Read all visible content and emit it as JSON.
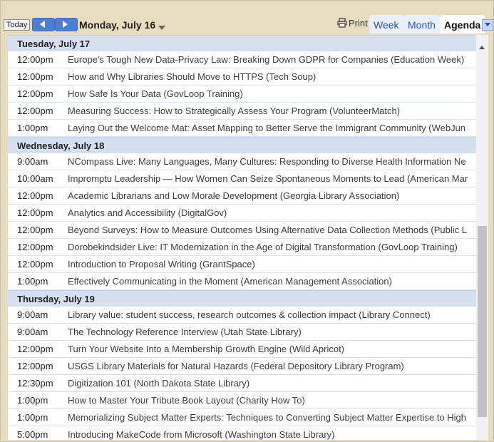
{
  "toolbar": {
    "today_label": "Today",
    "date_label": "Monday, July 16",
    "print_label": "Print",
    "tabs": [
      {
        "label": "Week"
      },
      {
        "label": "Month"
      },
      {
        "label": "Agenda"
      }
    ]
  },
  "agenda": [
    {
      "day": "Tuesday, July 17",
      "events": [
        {
          "time": "12:00pm",
          "title": "Europe's Tough New Data-Privacy Law: Breaking Down GDPR for Companies (Education Week)"
        },
        {
          "time": "12:00pm",
          "title": "How and Why Libraries Should Move to HTTPS (Tech Soup)"
        },
        {
          "time": "12:00pm",
          "title": "How Safe Is Your Data (GovLoop Training)"
        },
        {
          "time": "12:00pm",
          "title": "Measuring Success: How to Strategically Assess Your Program (VolunteerMatch)"
        },
        {
          "time": "1:00pm",
          "title": "Laying Out the Welcome Mat: Asset Mapping to Better Serve the Immigrant Community (WebJun"
        }
      ]
    },
    {
      "day": "Wednesday, July 18",
      "events": [
        {
          "time": "9:00am",
          "title": "NCompass Live: Many Languages, Many Cultures: Responding to Diverse Health Information Ne"
        },
        {
          "time": "10:00am",
          "title": "Impromptu Leadership — How Women Can Seize Spontaneous Moments to Lead (American Mar"
        },
        {
          "time": "12:00pm",
          "title": "Academic Librarians and Low Morale Development (Georgia Library Association)"
        },
        {
          "time": "12:00pm",
          "title": "Analytics and Accessibility (DigitalGov)"
        },
        {
          "time": "12:00pm",
          "title": "Beyond Surveys: How to Measure Outcomes Using Alternative Data Collection Methods (Public L"
        },
        {
          "time": "12:00pm",
          "title": "Dorobekindsider Live: IT Modernization in the Age of Digital Transformation (GovLoop Training)"
        },
        {
          "time": "12:00pm",
          "title": "Introduction to Proposal Writing (GrantSpace)"
        },
        {
          "time": "1:00pm",
          "title": "Effectively Communicating in the Moment (American Management Association)"
        }
      ]
    },
    {
      "day": "Thursday, July 19",
      "events": [
        {
          "time": "9:00am",
          "title": "Library value: student success, research outcomes & collection impact (Library Connect)"
        },
        {
          "time": "9:00am",
          "title": "The Technology Reference Interview (Utah State Library)"
        },
        {
          "time": "12:00pm",
          "title": "Turn Your Website Into a Membership Growth Engine (Wild Apricot)"
        },
        {
          "time": "12:00pm",
          "title": "USGS Library Materials for Natural Hazards (Federal Depository Library Program)"
        },
        {
          "time": "12:30pm",
          "title": "Digitization 101 (North Dakota State Library)"
        },
        {
          "time": "1:00pm",
          "title": "How to Master Your Tribute Book Layout (Charity How To)"
        },
        {
          "time": "1:00pm",
          "title": "Memorializing Subject Matter Experts: Techniques to Converting Subject Matter Expertise to High"
        },
        {
          "time": "5:00pm",
          "title": "Introducing MakeCode from Microsoft (Washington State Library)"
        }
      ]
    }
  ],
  "icons": {
    "prev": "chevron-left-icon",
    "next": "chevron-right-icon",
    "date_menu": "caret-down-icon",
    "print": "printer-icon",
    "view_menu": "caret-down-icon",
    "scroll_up": "arrow-up-icon"
  },
  "colors": {
    "toolbar_bg": "#e8dcbf",
    "nav_button": "#4b7fd1",
    "day_header_bg": "#d6dff0",
    "tab_bg": "#e8efff",
    "tab_text": "#2a4fb0"
  }
}
